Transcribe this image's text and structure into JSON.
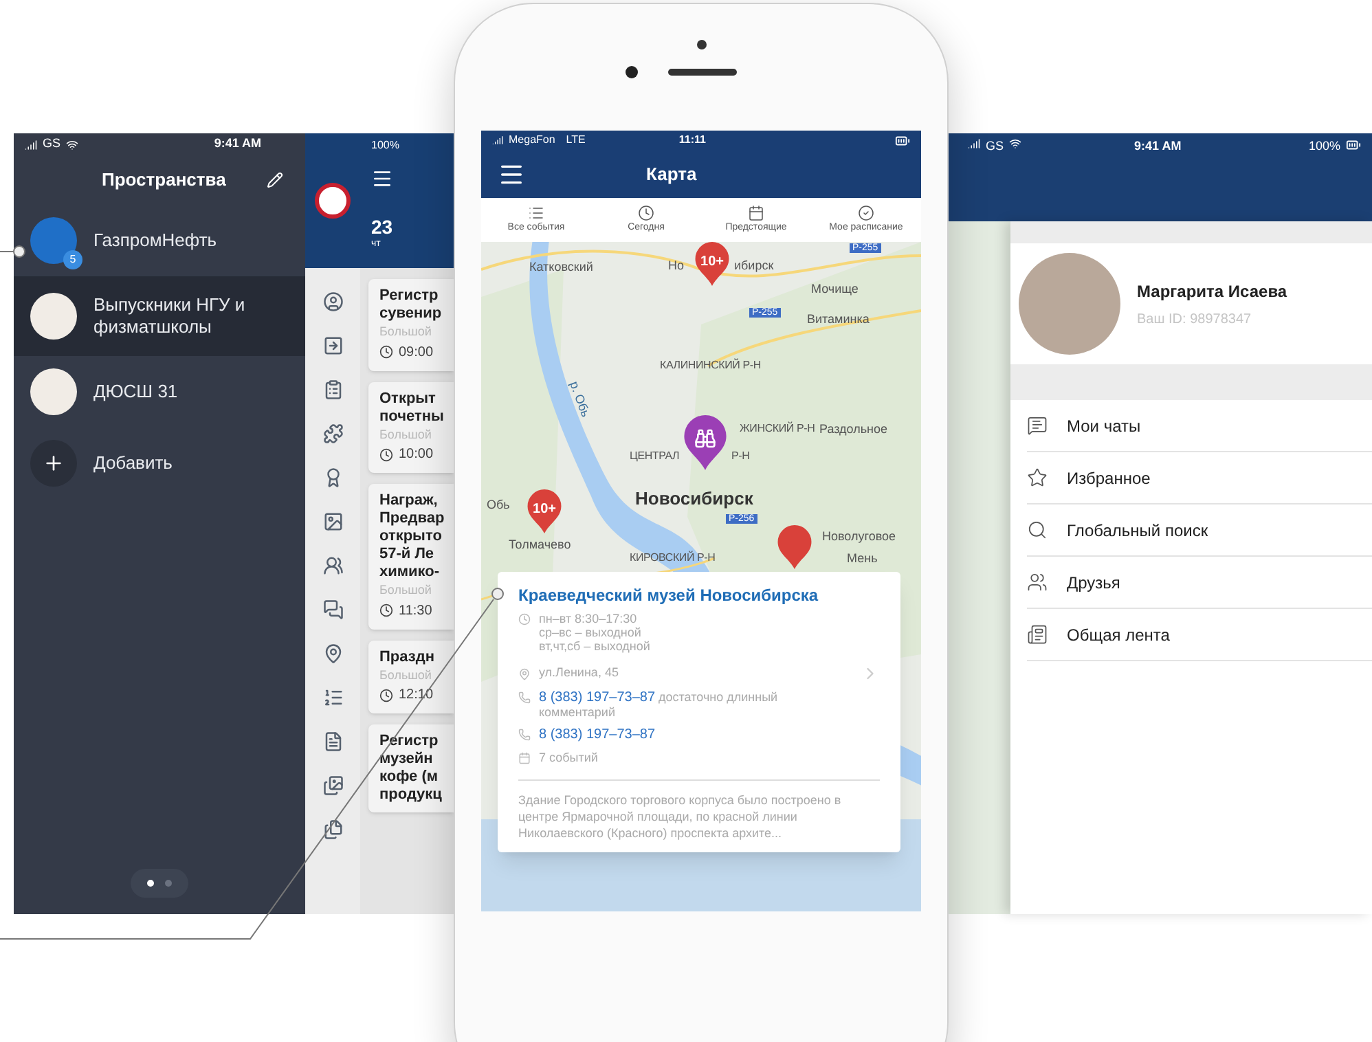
{
  "spaces_screen": {
    "status_bar": {
      "carrier": "GS",
      "time": "9:41 AM"
    },
    "title": "Пространства",
    "spaces": [
      {
        "name": "ГазпромНефть",
        "badge": "5",
        "selected": false
      },
      {
        "name": "Выпускники НГУ и физматшколы",
        "selected": true
      },
      {
        "name": "ДЮСШ 31",
        "selected": false
      }
    ],
    "add_label": "Добавить",
    "pager": [
      {
        "selected": true
      },
      {
        "selected": false
      }
    ]
  },
  "events_screen": {
    "battery": "100%",
    "date": "23",
    "weekday": "чт",
    "events": [
      {
        "title_lines": [
          "Регистр",
          "сувенир"
        ],
        "place": "Большой",
        "time": "09:00"
      },
      {
        "title_lines": [
          "Открыт",
          "почетны"
        ],
        "place": "Большой",
        "time": "10:00"
      },
      {
        "title_lines": [
          "Награж,",
          "Предвар",
          "открыто",
          "57-й Ле",
          "химико-"
        ],
        "place": "Большой",
        "time": "11:30"
      },
      {
        "title_lines": [
          "Праздн"
        ],
        "place": "Большой",
        "time": "12:10"
      },
      {
        "title_lines": [
          "Регистр",
          "музейн",
          "кофе (м",
          "продукц"
        ]
      }
    ]
  },
  "map_screen": {
    "status_bar": {
      "carrier": "MegaFon",
      "network": "LTE",
      "time": "11:11"
    },
    "title": "Карта",
    "tabs": [
      {
        "label": "Все события",
        "kind": "list"
      },
      {
        "label": "Сегодня",
        "kind": "clock"
      },
      {
        "label": "Предстоящие",
        "kind": "calendar"
      },
      {
        "label": "Мое расписание",
        "kind": "check"
      }
    ],
    "map_labels": [
      {
        "text": "Р-255",
        "kind": "road"
      },
      {
        "text": "Катковский",
        "kind": "town"
      },
      {
        "text": "Но",
        "kind": "town"
      },
      {
        "text": "ибирск",
        "kind": "town"
      },
      {
        "text": "Мочище",
        "kind": "town"
      },
      {
        "text": "Р-255",
        "kind": "road"
      },
      {
        "text": "Витаминка",
        "kind": "town"
      },
      {
        "text": "КАЛИНИНСКИЙ Р-Н",
        "kind": "district"
      },
      {
        "text": "р. Обь",
        "kind": "river"
      },
      {
        "text": "ЖИНСКИЙ Р-Н",
        "kind": "district"
      },
      {
        "text": "Раздольное",
        "kind": "town"
      },
      {
        "text": "ЦЕНТРАЛ",
        "kind": "district"
      },
      {
        "text": "Р-Н",
        "kind": "district"
      },
      {
        "text": "Обь",
        "kind": "town"
      },
      {
        "text": "Новосибирск",
        "kind": "city"
      },
      {
        "text": "Р-256",
        "kind": "road"
      },
      {
        "text": "Толмачево",
        "kind": "town"
      },
      {
        "text": "Новолуговое",
        "kind": "town"
      },
      {
        "text": "КИРОВСКИЙ Р-Н",
        "kind": "district"
      },
      {
        "text": "Мень",
        "kind": "town"
      }
    ],
    "pins": [
      {
        "kind": "cluster",
        "label": "10+"
      },
      {
        "kind": "place"
      },
      {
        "kind": "cluster",
        "label": "10+"
      },
      {
        "kind": "cluster"
      }
    ],
    "card": {
      "title": "Краеведческий музей Новосибирска",
      "hours": [
        "пн–вт 8:30–17:30",
        "ср–вс – выходной",
        "вт,чт,сб – выходной"
      ],
      "address": "ул.Ленина, 45",
      "phones": [
        {
          "number": "8 (383) 197–73–87",
          "comment": "достаточно длинный комментарий"
        },
        {
          "number": "8 (383) 197–73–87"
        }
      ],
      "events": "7 событий",
      "description": "Здание Городского торгового корпуса было построено в центре Ярмарочной площади, по красной линии Николаевского (Красного) проспекта архите..."
    }
  },
  "profile_screen": {
    "status_bar": {
      "carrier": "GS",
      "time": "9:41 AM",
      "battery": "100%"
    },
    "name": "Маргарита Исаева",
    "user_id": "Ваш ID: 98978347",
    "menu": [
      {
        "label": "Мои чаты",
        "kind": "chats"
      },
      {
        "label": "Избранное",
        "kind": "favorites"
      },
      {
        "label": "Глобальный поиск",
        "kind": "search"
      },
      {
        "label": "Друзья",
        "kind": "friends"
      },
      {
        "label": "Общая лента",
        "kind": "feed"
      }
    ]
  }
}
